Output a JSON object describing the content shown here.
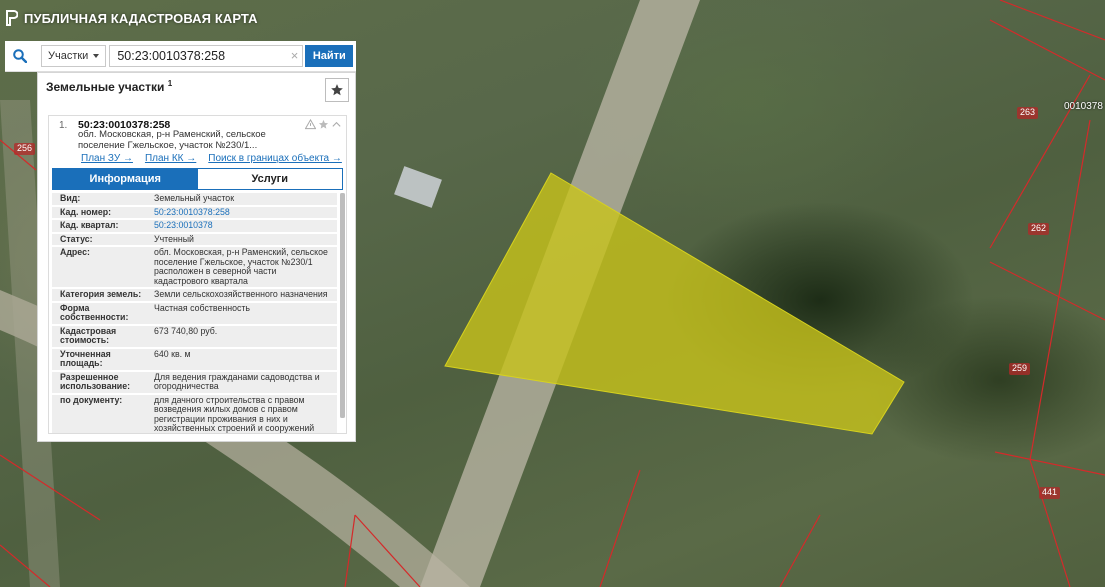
{
  "app": {
    "title": "ПУБЛИЧНАЯ КАДАСТРОВАЯ КАРТА"
  },
  "search": {
    "type_label": "Участки",
    "query": "50:23:0010378:258",
    "find_label": "Найти",
    "clear_glyph": "×"
  },
  "panel": {
    "title": "Земельные участки",
    "count": "1",
    "result": {
      "num": "1.",
      "cad_number": "50:23:0010378:258",
      "address_short": "обл. Московская, р-н Раменский, сельское поселение Гжельское, участок №230/1...",
      "links": [
        "План ЗУ →",
        "План КК →",
        "Поиск в границах объекта →"
      ],
      "tabs": [
        {
          "label": "Информация",
          "active": true
        },
        {
          "label": "Услуги",
          "active": false
        }
      ],
      "info": [
        {
          "key": "Вид:",
          "value": "Земельный участок",
          "link": false
        },
        {
          "key": "Кад. номер:",
          "value": "50:23:0010378:258",
          "link": true
        },
        {
          "key": "Кад. квартал:",
          "value": "50:23:0010378",
          "link": true
        },
        {
          "key": "Статус:",
          "value": "Учтенный",
          "link": false
        },
        {
          "key": "Адрес:",
          "value": "обл. Московская, р-н Раменский, сельское поселение Гжельское, участок №230/1 расположен в северной части кадастрового квартала",
          "link": false
        },
        {
          "key": "Категория земель:",
          "value": "Земли сельскохозяйственного назначения",
          "link": false
        },
        {
          "key": "Форма собственности:",
          "value": "Частная собственность",
          "link": false
        },
        {
          "key": "Кадастровая стоимость:",
          "value": "673 740,80 руб.",
          "link": false
        },
        {
          "key": "Уточненная площадь:",
          "value": "640 кв. м",
          "link": false
        },
        {
          "key": "Разрешенное использование:",
          "value": "Для ведения гражданами садоводства и огородничества",
          "link": false
        },
        {
          "key": "по документу:",
          "value": "для дачного строительства с правом возведения жилых домов с правом регистрации проживания в них и хозяйственных строений и сооружений",
          "link": false
        }
      ]
    }
  },
  "map": {
    "parcel_labels": [
      "256",
      "263",
      "262",
      "259",
      "441",
      "0010378"
    ],
    "highlight_color": "#c8c31a",
    "boundary_color": "#d42a2a",
    "accent": "#1a6fba"
  }
}
